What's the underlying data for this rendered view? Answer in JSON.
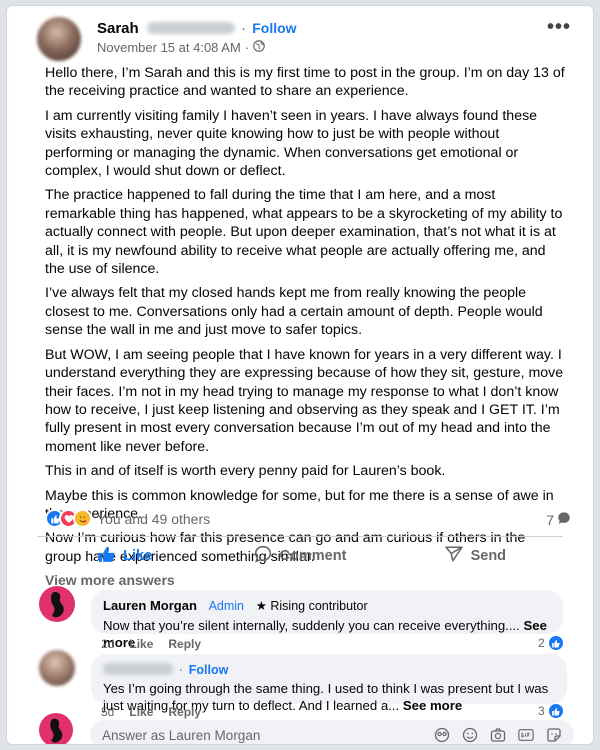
{
  "post": {
    "author": "Sarah",
    "follow_label": "Follow",
    "timestamp": "November 15 at 4:08 AM",
    "separator": "·",
    "paragraphs": [
      "Hello there, I’m Sarah and this is my first time to post in the group. I’m on day 13 of the receiving practice and wanted to share an experience.",
      "I am currently visiting family I haven’t seen in years. I have always found these visits exhausting, never quite knowing how to just be with people without performing or managing the dynamic. When conversations get emotional or complex, I would shut down or deflect.",
      "The practice happened to fall during the time that I am here, and a most remarkable thing has happened, what appears to be a skyrocketing of my ability to actually connect with people. But upon deeper examination, that’s not what it is at all, it is my newfound ability to receive what people are actually offering me, and the use of silence.",
      "I’ve always felt that my closed hands kept me from really knowing the people closest to me. Conversations only had a certain amount of depth. People would sense the wall in me and just move to safer topics.",
      "But WOW, I am seeing people that I have known for years in a very different way. I understand everything they are expressing because of how they sit, gesture, move their faces. I’m not in my head trying to manage my response to what I don’t know how to receive, I just keep listening and observing as they speak and I GET IT. I’m fully present in most every conversation because I’m out of my head and into the moment like never before.",
      "This in and of itself is worth every penny paid for Lauren’s book.",
      "Maybe this is common knowledge for some, but for me there is a sense of awe in the experience.",
      "Now I’m curious how far this presence can go and am curious if others in the group have experienced something similar."
    ]
  },
  "reactions": {
    "summary": "You and 49 others",
    "comment_count": "7",
    "icons": [
      "like-reaction",
      "love-reaction",
      "care-reaction"
    ],
    "colors": {
      "like": "#1877f2",
      "love": "#f33e58",
      "care": "#f7b928"
    }
  },
  "actions": {
    "like": "Like",
    "comment": "Comment",
    "send": "Send"
  },
  "view_more": "View more answers",
  "comments": [
    {
      "name": "Lauren Morgan",
      "badge_admin": "Admin",
      "badge_rising": "Rising contributor",
      "text": "Now that you’re silent internally, suddenly you can receive everything.... ",
      "see_more": "See more",
      "age": "2d",
      "like": "Like",
      "reply": "Reply",
      "likes": "2"
    },
    {
      "separator": "·",
      "follow": "Follow",
      "text": "Yes I’m going through the same thing. I used to think I was present but I was just waiting for my turn to deflect. And I learned a... ",
      "see_more": "See more",
      "age": "5d",
      "like": "Like",
      "reply": "Reply",
      "likes": "3"
    }
  ],
  "composer": {
    "placeholder": "Answer as Lauren Morgan"
  },
  "accent": "#1877f2"
}
